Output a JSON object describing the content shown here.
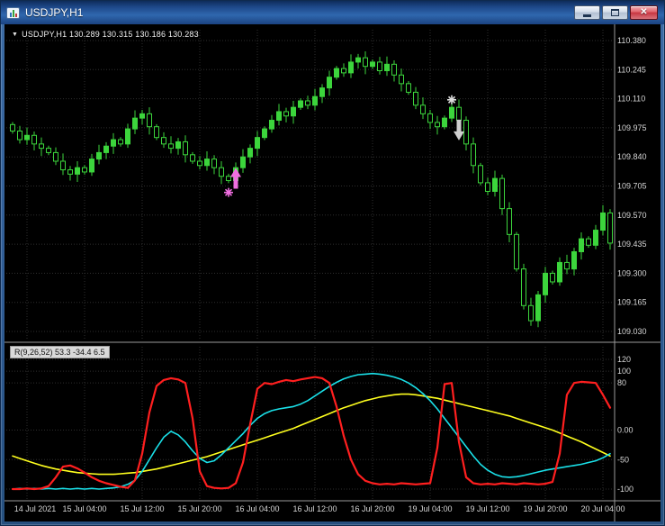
{
  "titlebar": {
    "title": "USDJPY,H1",
    "close_glyph": "✕"
  },
  "chart": {
    "header_text": "USDJPY,H1 130.289 130.315 130.186 130.283",
    "dropdown_glyph": "▼"
  },
  "indicator_label": "R(9,26,52) 53.3 -34.4 6.5",
  "colors": {
    "background": "#000000",
    "candle": "#3cd53c",
    "grid": "#2e2e2e",
    "axis_text": "#d6d6d6",
    "separator": "#9a9a9a"
  },
  "chart_data": {
    "type": "candlestick_with_oscillator",
    "symbol": "USDJPY",
    "period": "H1",
    "price_axis": [
      "110.380",
      "110.245",
      "110.110",
      "109.975",
      "109.840",
      "109.705",
      "109.570",
      "109.435",
      "109.300",
      "109.165",
      "109.030"
    ],
    "time_labels": [
      "14 Jul 2021",
      "15 Jul 04:00",
      "15 Jul 12:00",
      "15 Jul 20:00",
      "16 Jul 04:00",
      "16 Jul 12:00",
      "16 Jul 20:00",
      "19 Jul 04:00",
      "19 Jul 12:00",
      "19 Jul 20:00",
      "20 Jul 04:00"
    ],
    "candles": {
      "closes": [
        109.96,
        109.92,
        109.94,
        109.9,
        109.88,
        109.86,
        109.82,
        109.78,
        109.76,
        109.79,
        109.77,
        109.83,
        109.86,
        109.89,
        109.92,
        109.9,
        109.97,
        110.02,
        110.04,
        109.98,
        109.93,
        109.9,
        109.88,
        109.91,
        109.85,
        109.82,
        109.8,
        109.83,
        109.79,
        109.75,
        109.73,
        109.79,
        109.84,
        109.88,
        109.93,
        109.97,
        110.01,
        110.05,
        110.03,
        110.07,
        110.1,
        110.08,
        110.12,
        110.16,
        110.21,
        110.25,
        110.23,
        110.28,
        110.3,
        110.26,
        110.28,
        110.24,
        110.27,
        110.22,
        110.18,
        110.14,
        110.08,
        110.04,
        110.0,
        109.98,
        110.02,
        110.07,
        110.01,
        109.9,
        109.8,
        109.72,
        109.68,
        109.74,
        109.6,
        109.48,
        109.32,
        109.15,
        109.08,
        109.2,
        109.3,
        109.26,
        109.35,
        109.32,
        109.4,
        109.46,
        109.43,
        109.5,
        109.58,
        109.44
      ]
    },
    "oscillator": {
      "label": "R(9,26,52) 53.3 -34.4 6.5",
      "axis_labels": [
        "120",
        "100",
        "80",
        "0.00",
        "-50",
        "-100"
      ],
      "series": [
        {
          "name": "yellow-line",
          "color": "#ffff1e",
          "width": 1.6,
          "values": [
            -44,
            -48,
            -52,
            -56,
            -60,
            -63,
            -66,
            -68,
            -70,
            -72,
            -73,
            -74,
            -75,
            -75,
            -75,
            -74,
            -73,
            -72,
            -70,
            -68,
            -66,
            -63,
            -60,
            -57,
            -54,
            -51,
            -48,
            -45,
            -41,
            -37,
            -33,
            -29,
            -25,
            -21,
            -17,
            -13,
            -9,
            -5,
            -1,
            3,
            8,
            13,
            18,
            23,
            28,
            33,
            38,
            42,
            46,
            50,
            53,
            56,
            58,
            60,
            61,
            61,
            60,
            58,
            56,
            54,
            51,
            48,
            45,
            42,
            39,
            36,
            33,
            30,
            27,
            24,
            20,
            16,
            12,
            8,
            4,
            0,
            -5,
            -10,
            -15,
            -20,
            -26,
            -32,
            -38,
            -44
          ]
        },
        {
          "name": "cyan-line",
          "color": "#1ae0e8",
          "width": 1.6,
          "values": [
            -100,
            -99,
            -100,
            -99,
            -100,
            -99,
            -100,
            -99,
            -100,
            -99,
            -100,
            -99,
            -100,
            -99,
            -98,
            -96,
            -92,
            -85,
            -70,
            -50,
            -30,
            -12,
            -2,
            -8,
            -20,
            -35,
            -48,
            -55,
            -52,
            -42,
            -30,
            -18,
            -6,
            8,
            20,
            28,
            33,
            36,
            38,
            40,
            44,
            50,
            58,
            66,
            74,
            81,
            87,
            91,
            94,
            95,
            96,
            95,
            93,
            90,
            86,
            80,
            72,
            62,
            50,
            36,
            20,
            4,
            -12,
            -28,
            -44,
            -58,
            -68,
            -75,
            -79,
            -80,
            -79,
            -77,
            -74,
            -71,
            -68,
            -66,
            -64,
            -62,
            -60,
            -58,
            -55,
            -52,
            -47,
            -40
          ]
        },
        {
          "name": "red-line",
          "color": "#ff1f1f",
          "width": 2.2,
          "values": [
            -100,
            -100,
            -99,
            -100,
            -99,
            -95,
            -80,
            -62,
            -60,
            -65,
            -72,
            -80,
            -86,
            -90,
            -93,
            -96,
            -98,
            -85,
            -40,
            30,
            75,
            85,
            88,
            86,
            80,
            20,
            -70,
            -95,
            -98,
            -99,
            -98,
            -90,
            -55,
            10,
            70,
            80,
            78,
            82,
            85,
            83,
            86,
            88,
            90,
            88,
            80,
            40,
            -10,
            -50,
            -75,
            -86,
            -90,
            -92,
            -91,
            -92,
            -90,
            -91,
            -92,
            -91,
            -90,
            -30,
            78,
            80,
            -20,
            -80,
            -90,
            -92,
            -91,
            -92,
            -90,
            -91,
            -92,
            -90,
            -91,
            -92,
            -91,
            -88,
            -40,
            60,
            80,
            82,
            81,
            80,
            60,
            38
          ]
        }
      ]
    },
    "markers": [
      {
        "shape": "star",
        "color": "#f06ee0",
        "i": 30,
        "price": 109.675
      },
      {
        "shape": "arrow-up",
        "color": "#f06ee0",
        "i": 31,
        "price": 109.73
      },
      {
        "shape": "star",
        "color": "#dcdcdc",
        "i": 61,
        "price": 110.105
      },
      {
        "shape": "arrow-down",
        "color": "#cfcfcf",
        "i": 62,
        "price": 109.975
      }
    ]
  }
}
